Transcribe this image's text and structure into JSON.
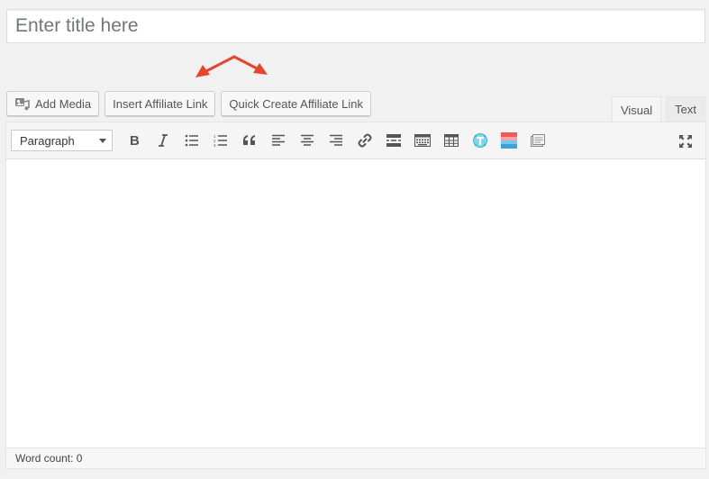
{
  "title_field": {
    "placeholder": "Enter title here",
    "value": ""
  },
  "media_buttons": {
    "add_media": "Add Media",
    "insert_affiliate_link": "Insert Affiliate Link",
    "quick_create_affiliate_link": "Quick Create Affiliate Link"
  },
  "tabs": {
    "visual": "Visual",
    "text": "Text",
    "active": "visual"
  },
  "toolbar": {
    "format_select": "Paragraph",
    "buttons": [
      "bold-icon",
      "italic-icon",
      "bulleted-list-icon",
      "numbered-list-icon",
      "blockquote-icon",
      "align-left-icon",
      "align-center-icon",
      "align-right-icon",
      "link-icon",
      "read-more-icon",
      "toolbar-toggle-icon",
      "table-icon",
      "plugin-cyan-icon",
      "plugin-color-grid-icon",
      "plugin-gray-icon",
      "fullscreen-icon"
    ]
  },
  "status_bar": {
    "word_count": "Word count: 0"
  },
  "colors": {
    "annotation_arrows": "#e8442a",
    "background": "#f1f1f1",
    "toolbar_bg": "#f5f5f5"
  }
}
